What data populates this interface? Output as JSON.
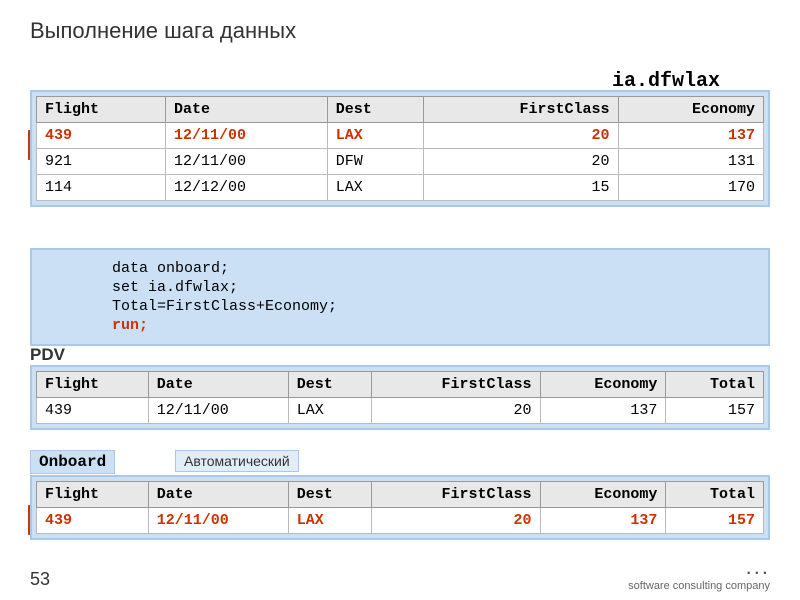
{
  "page": {
    "title": "Выполнение шага данных",
    "number": "53"
  },
  "label_ia": "ia.dfwlax",
  "label_pdv": "PDV",
  "label_onboard": "Onboard",
  "label_avtomaticheski": "Автоматический",
  "top_table": {
    "headers": [
      "Flight",
      "Date",
      "Dest",
      "FirstClass",
      "Economy"
    ],
    "rows": [
      {
        "flight": "439",
        "date": "12/11/00",
        "dest": "LAX",
        "firstclass": "20",
        "economy": "137",
        "highlight": true
      },
      {
        "flight": "921",
        "date": "12/11/00",
        "dest": "DFW",
        "firstclass": "20",
        "economy": "131",
        "highlight": false
      },
      {
        "flight": "114",
        "date": "12/12/00",
        "dest": "LAX",
        "firstclass": "15",
        "economy": "170",
        "highlight": false
      }
    ]
  },
  "code_block": {
    "line1": "data onboard;",
    "line2": "set ia.dfwlax;",
    "line3": "Total=FirstClass+Economy;",
    "line4_keyword": "run;"
  },
  "pdv_table": {
    "headers": [
      "Flight",
      "Date",
      "Dest",
      "FirstClass",
      "Economy",
      "Total"
    ],
    "rows": [
      {
        "flight": "439",
        "date": "12/11/00",
        "dest": "LAX",
        "firstclass": "20",
        "economy": "137",
        "total": "157",
        "highlight": false
      }
    ]
  },
  "onboard_table": {
    "headers": [
      "Flight",
      "Date",
      "Dest",
      "FirstClass",
      "Economy",
      "Total"
    ],
    "rows": [
      {
        "flight": "439",
        "date": "12/11/00",
        "dest": "LAX",
        "firstclass": "20",
        "economy": "137",
        "total": "157",
        "highlight": true
      }
    ]
  },
  "logo": {
    "text": "software consulting company",
    "dots": "..."
  }
}
